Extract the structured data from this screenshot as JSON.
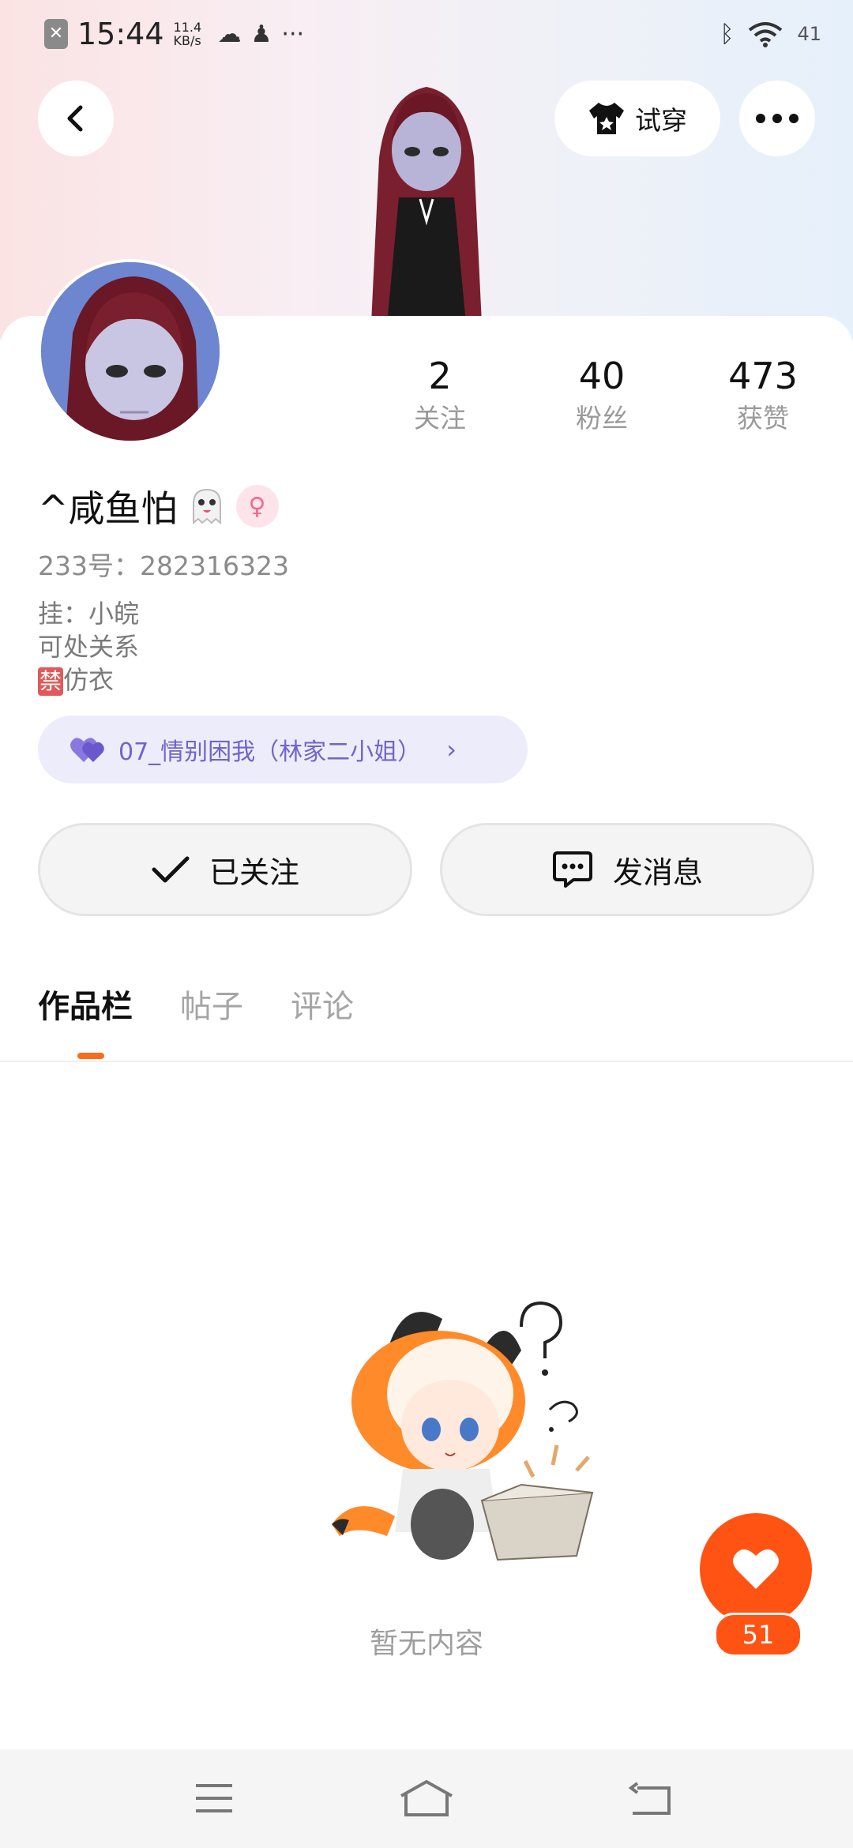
{
  "status_bar": {
    "time": "15:44",
    "speed_value": "11.4",
    "speed_unit": "KB/s",
    "more": "···",
    "battery": "41"
  },
  "header": {
    "tryon_label": "试穿"
  },
  "profile": {
    "stats": [
      {
        "value": "2",
        "label": "关注"
      },
      {
        "value": "40",
        "label": "粉丝"
      },
      {
        "value": "473",
        "label": "获赞"
      }
    ],
    "name": "^咸鱼怕",
    "id_line": "233号：282316323",
    "bio_line1": "挂：小皖",
    "bio_line2": "可处关系",
    "bio_ban_tag": "禁",
    "bio_line3_rest": "仿衣",
    "music_title": "07_情别困我（林家二小姐）"
  },
  "actions": {
    "followed_label": "已关注",
    "message_label": "发消息"
  },
  "tabs": [
    {
      "label": "作品栏"
    },
    {
      "label": "帖子"
    },
    {
      "label": "评论"
    }
  ],
  "empty": {
    "text": "暂无内容"
  },
  "fab": {
    "likes": "51"
  },
  "colors": {
    "accent": "#ff5314",
    "tab_underline": "#ff6a1a",
    "music_text": "#7264c8",
    "music_bg": "#ececfb"
  }
}
